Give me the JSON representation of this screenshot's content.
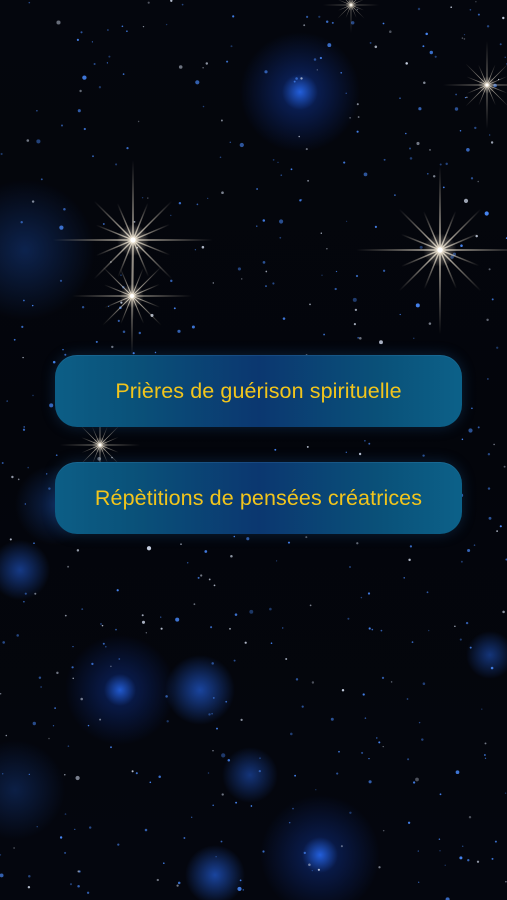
{
  "background": {
    "image": "starry-night-sky",
    "colors": {
      "base": "#03050b",
      "glow": "#286eff",
      "sparkle": "#e8dcc8"
    }
  },
  "menu": {
    "items": [
      {
        "label": "Prières de guérison spirituelle"
      },
      {
        "label": "Répètitions de pensées créatrices"
      }
    ],
    "colors": {
      "button_edge": "#0c5e86",
      "button_center": "#0b3770",
      "label": "#f2c51c"
    }
  }
}
